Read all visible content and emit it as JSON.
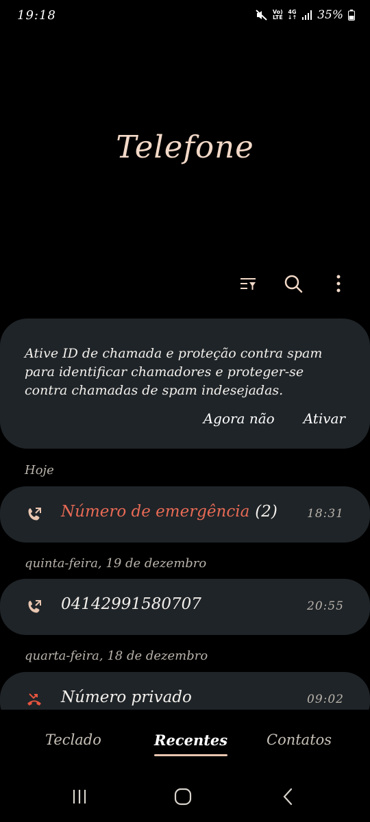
{
  "status_bar": {
    "time": "19:18",
    "volte_top": "Vo)",
    "volte_bottom": "LTE",
    "network_top": "4G",
    "network_bottom": "↓↑",
    "battery": "35%",
    "icons": [
      "mute-icon",
      "signal-icon",
      "battery-icon"
    ]
  },
  "app": {
    "title": "Telefone"
  },
  "toolbar": {
    "icons": [
      "filter-icon",
      "search-icon",
      "more-options-icon"
    ]
  },
  "spam_banner": {
    "message": "Ative ID de chamada e proteção contra spam para identificar chamadores e proteger-se contra chamadas de spam indesejadas.",
    "dismiss_label": "Agora não",
    "enable_label": "Ativar"
  },
  "recents": [
    {
      "date": "Hoje",
      "call": {
        "name": "Número de emergência",
        "count": "(2)",
        "time": "18:31",
        "icon": "outgoing-call-icon",
        "name_color": "#e86a55"
      }
    },
    {
      "date": "quinta-feira, 19 de dezembro",
      "call": {
        "name": "04142991580707",
        "count": "",
        "time": "20:55",
        "icon": "outgoing-call-icon"
      }
    },
    {
      "date": "quarta-feira, 18 de dezembro",
      "call": {
        "name": "Número privado",
        "count": "",
        "time": "09:02",
        "icon": "missed-call-icon"
      }
    }
  ],
  "tabs": {
    "keypad": "Teclado",
    "recents": "Recentes",
    "contacts": "Contatos",
    "active": "Recentes"
  },
  "nav": {
    "icons": [
      "recent-apps-icon",
      "home-icon",
      "back-icon"
    ]
  },
  "colors": {
    "accent": "#e9c6b1",
    "card_bg": "#1f2428",
    "missed_red": "#e8553f",
    "emergency_red": "#e86a55"
  }
}
